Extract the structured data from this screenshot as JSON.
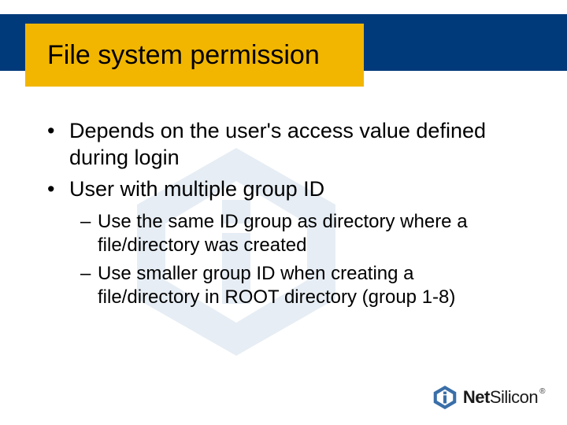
{
  "slide": {
    "title": "File system permission",
    "bullets": {
      "b1": "Depends on the user's access value defined during login",
      "b2": "User with multiple group ID",
      "sub1": "Use the same ID group as directory where a file/directory was created",
      "sub2": "Use smaller group ID when creating a file/directory in ROOT directory (group 1-8)"
    }
  },
  "brand": {
    "name_bold": "Net",
    "name_light": "Silicon",
    "reg": "®",
    "accent_color": "#3a6fa8"
  }
}
